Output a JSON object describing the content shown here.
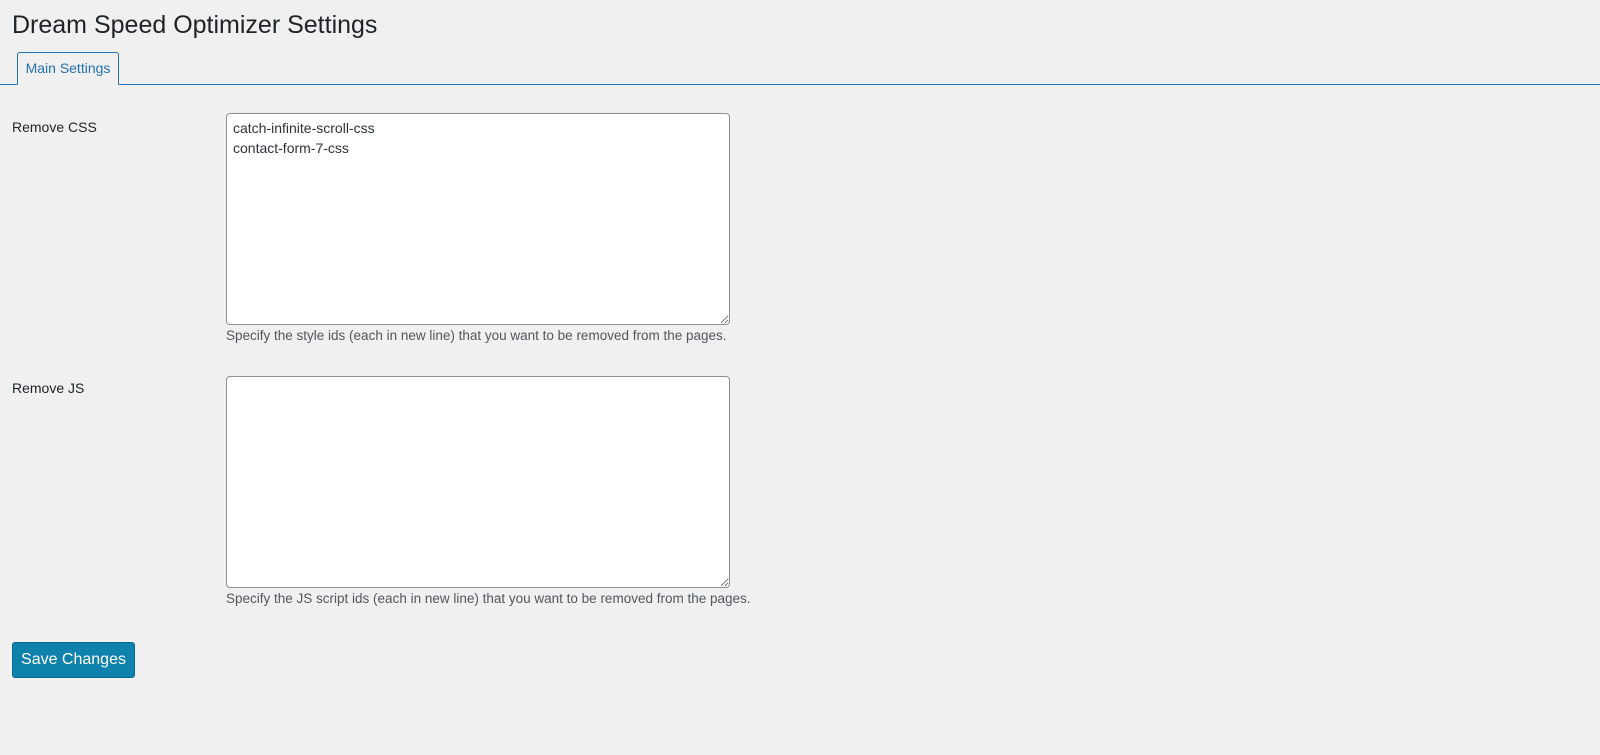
{
  "page": {
    "title": "Dream Speed Optimizer Settings"
  },
  "tabs": [
    {
      "label": "Main Settings",
      "active": true
    }
  ],
  "fields": {
    "remove_css": {
      "label": "Remove CSS",
      "value": "catch-infinite-scroll-css\ncontact-form-7-css",
      "description": "Specify the style ids (each in new line) that you want to be removed from the pages."
    },
    "remove_js": {
      "label": "Remove JS",
      "value": "",
      "description": "Specify the JS script ids (each in new line) that you want to be removed from the pages."
    }
  },
  "actions": {
    "save_label": "Save Changes"
  },
  "colors": {
    "background": "#f0f0f1",
    "accent": "#2271b1",
    "button": "#0f81ad"
  }
}
